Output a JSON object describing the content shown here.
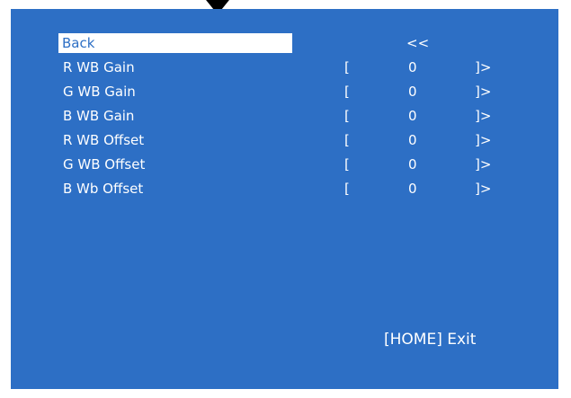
{
  "menu": {
    "back_label": "Back",
    "back_indicator": "<<",
    "items": [
      {
        "label": "R WB Gain",
        "left_bracket": "[",
        "value": "0",
        "right_bracket": "]>"
      },
      {
        "label": "G WB Gain",
        "left_bracket": "[",
        "value": "0",
        "right_bracket": "]>"
      },
      {
        "label": "B WB Gain",
        "left_bracket": "[",
        "value": "0",
        "right_bracket": "]>"
      },
      {
        "label": "R WB Offset",
        "left_bracket": "[",
        "value": "0",
        "right_bracket": "]>"
      },
      {
        "label": "G WB Offset",
        "left_bracket": "[",
        "value": "0",
        "right_bracket": "]>"
      },
      {
        "label": "B Wb Offset",
        "left_bracket": "[",
        "value": "0",
        "right_bracket": "]>"
      }
    ]
  },
  "footer": {
    "exit_hint": "[HOME] Exit"
  },
  "colors": {
    "panel_background": "#2d6fc5",
    "text": "#ffffff",
    "highlight_background": "#ffffff",
    "highlight_text": "#2d6fc5",
    "pointer": "#000000"
  }
}
